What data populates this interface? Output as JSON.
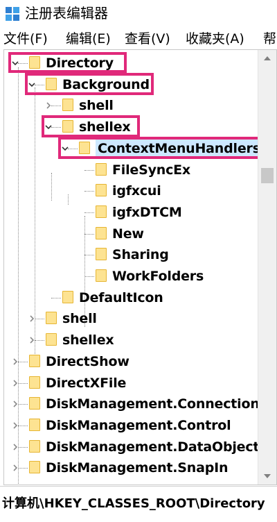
{
  "window": {
    "title": "注册表编辑器",
    "icon": "registry-editor-icon"
  },
  "menu": [
    "文件(F)",
    "编辑(E)",
    "查看(V)",
    "收藏夹(A)",
    "帮"
  ],
  "tree": [
    {
      "label": "Directory",
      "state": "expanded",
      "highlighted": true
    },
    {
      "label": "Background",
      "state": "expanded",
      "highlighted": true
    },
    {
      "label": "shell",
      "state": "collapsed"
    },
    {
      "label": "shellex",
      "state": "expanded",
      "highlighted": true
    },
    {
      "label": "ContextMenuHandlers",
      "state": "expanded",
      "highlighted": true,
      "selected": true
    },
    {
      "label": "FileSyncEx",
      "state": "leaf"
    },
    {
      "label": "igfxcui",
      "state": "leaf"
    },
    {
      "label": "igfxDTCM",
      "state": "leaf"
    },
    {
      "label": "New",
      "state": "leaf"
    },
    {
      "label": "Sharing",
      "state": "leaf"
    },
    {
      "label": "WorkFolders",
      "state": "leaf"
    },
    {
      "label": "DefaultIcon",
      "state": "leaf"
    },
    {
      "label": "shell",
      "state": "collapsed"
    },
    {
      "label": "shellex",
      "state": "collapsed"
    },
    {
      "label": "DirectShow",
      "state": "collapsed"
    },
    {
      "label": "DirectXFile",
      "state": "collapsed"
    },
    {
      "label": "DiskManagement.Connection",
      "state": "collapsed"
    },
    {
      "label": "DiskManagement.Control",
      "state": "collapsed"
    },
    {
      "label": "DiskManagement.DataObject",
      "state": "collapsed"
    },
    {
      "label": "DiskManagement.SnapIn",
      "state": "collapsed"
    }
  ],
  "statusbar": {
    "path": "计算机\\HKEY_CLASSES_ROOT\\Directory"
  },
  "colors": {
    "highlight_border": "#e0297a",
    "folder_fill": "#fde392",
    "selection": "#cde8ff"
  }
}
